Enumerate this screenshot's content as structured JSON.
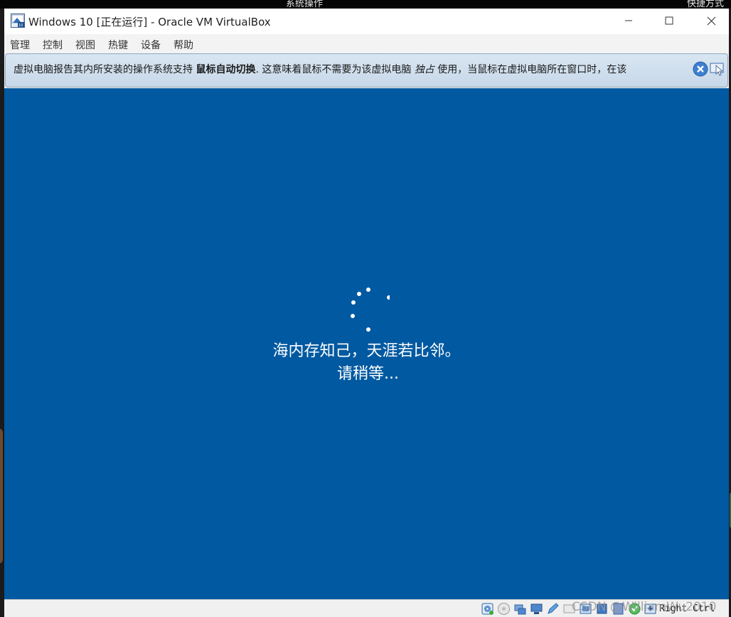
{
  "host": {
    "top_label_left": "系统操作",
    "top_label_right": "快捷方式"
  },
  "window": {
    "title": "Windows 10 [正在运行] - Oracle VM VirtualBox",
    "controls": [
      "minimize-icon",
      "maximize-icon",
      "close-icon"
    ]
  },
  "menu": {
    "items": [
      "管理",
      "控制",
      "视图",
      "热键",
      "设备",
      "帮助"
    ]
  },
  "banner": {
    "text_1": "虚拟电脑报告其内所安装的操作系统支持",
    "bold": "鼠标自动切换",
    "text_2": ". 这意味着鼠标不需要为该虚拟电脑",
    "italic": "独占",
    "text_3": "使用，当鼠标在虚拟电脑所在窗口时，在该",
    "icons": [
      "close-banner-icon",
      "mouse-integration-icon"
    ]
  },
  "vm": {
    "background": "#0059a1",
    "line1": "海内存知己，天涯若比邻。",
    "line2": "请稍等..."
  },
  "status": {
    "icons": [
      "optical-drive-icon",
      "audio-icon",
      "network-icon",
      "usb-icon",
      "shared-folders-icon",
      "display-icon",
      "video-capture-icon",
      "cpu-icon",
      "arrow-icon",
      "keyboard-icon",
      "mouse-icon"
    ],
    "host_key": "Right Ctrl",
    "watermark": "CSDN @WilliamWu2010"
  }
}
